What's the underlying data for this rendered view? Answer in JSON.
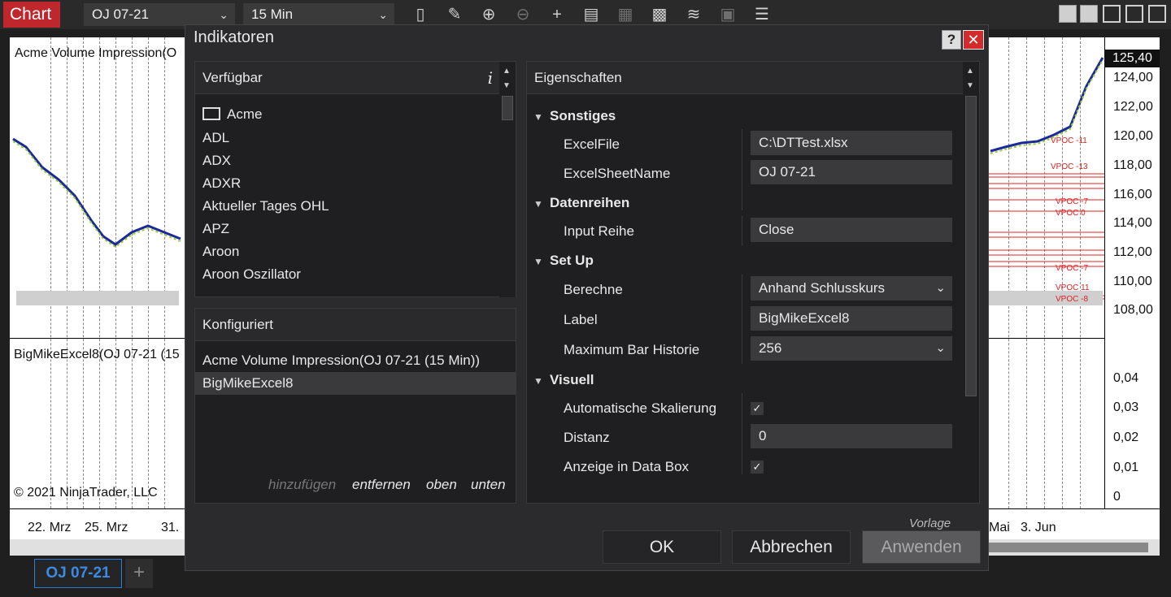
{
  "topbar": {
    "title": "Chart",
    "instrument": "OJ 07-21",
    "interval": "15 Min",
    "icons": [
      "bar-type-icon",
      "pencil-icon",
      "zoom-in-icon",
      "zoom-out-icon",
      "crosshair-icon",
      "data-series-icon",
      "template-icon",
      "chart-trader-icon",
      "strategy-icon",
      "disabled-icon",
      "properties-icon"
    ]
  },
  "chart": {
    "panel1_label": "Acme Volume Impression(O",
    "panel2_label": "BigMikeExcel8(OJ 07-21 (15",
    "copyright": "© 2021 NinjaTrader, LLC",
    "current_price": "125,40",
    "price_ticks": [
      "124,00",
      "122,00",
      "120,00",
      "118,00",
      "116,00",
      "114,00",
      "112,00",
      "110,00",
      "108,00"
    ],
    "lower_ticks": [
      "0,04",
      "0,03",
      "0,02",
      "0,01",
      "0"
    ],
    "dates": [
      "22. Mrz",
      "25. Mrz",
      "31.",
      "Mai",
      "3. Jun"
    ],
    "vpoc_labels": [
      "VPOC -11",
      "VPOC -13",
      "VPOC -7",
      "VPOC 0",
      "VPOC -7",
      "VPOC 11",
      "VPOC -8"
    ]
  },
  "tabs": {
    "active": "OJ 07-21",
    "add": "+"
  },
  "dialog": {
    "title": "Indikatoren",
    "help": "?",
    "close": "✕",
    "available": {
      "header": "Verfügbar",
      "info": "i",
      "folder": "Acme",
      "items": [
        "ADL",
        "ADX",
        "ADXR",
        "Aktueller Tages OHL",
        "APZ",
        "Aroon",
        "Aroon Oszillator"
      ]
    },
    "configured": {
      "header": "Konfiguriert",
      "items": [
        "Acme Volume Impression(OJ 07-21 (15 Min))",
        "BigMikeExcel8"
      ],
      "actions": {
        "add": "hinzufügen",
        "remove": "entfernen",
        "up": "oben",
        "down": "unten"
      }
    },
    "properties": {
      "header": "Eigenschaften",
      "groups": {
        "misc": "Sonstiges",
        "data": "Datenreihen",
        "setup": "Set Up",
        "visual": "Visuell"
      },
      "excel_file_label": "ExcelFile",
      "excel_file_value": "C:\\DTTest.xlsx",
      "excel_sheet_label": "ExcelSheetName",
      "excel_sheet_value": "OJ 07-21",
      "input_label": "Input Reihe",
      "input_value": "Close",
      "calc_label": "Berechne",
      "calc_value": "Anhand Schlusskurs",
      "label_label": "Label",
      "label_value": "BigMikeExcel8",
      "maxbars_label": "Maximum Bar Historie",
      "maxbars_value": "256",
      "autoscale_label": "Automatische Skalierung",
      "autoscale_checked": true,
      "distance_label": "Distanz",
      "distance_value": "0",
      "databox_label": "Anzeige in Data Box",
      "databox_checked": true,
      "template": "Vorlage"
    },
    "buttons": {
      "ok": "OK",
      "cancel": "Abbrechen",
      "apply": "Anwenden"
    }
  },
  "colors": {
    "chart_red": "#c0272d",
    "tab_blue": "#2e7bd6",
    "close_red": "#d32b2b",
    "vpoc_red": "#e02020"
  }
}
